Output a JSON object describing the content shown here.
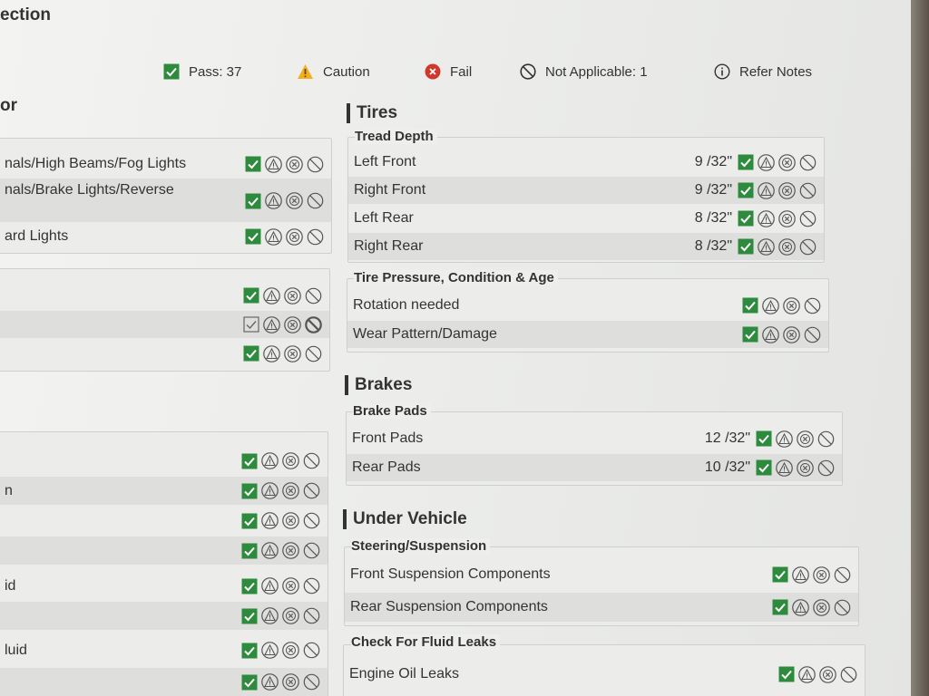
{
  "page": {
    "title": "ection"
  },
  "legend": {
    "pass": "Pass: 37",
    "caution": "Caution",
    "fail": "Fail",
    "na": "Not Applicable: 1",
    "notes": "Refer Notes"
  },
  "colors": {
    "pass_green": "#2e8b3e",
    "caution_yellow": "#f2b01e",
    "fail_red": "#d0382b",
    "icon_gray": "#555555"
  },
  "left": {
    "section1": {
      "title": "or",
      "items": [
        {
          "label": "nals/High Beams/Fog Lights"
        },
        {
          "label": "nals/Brake Lights/Reverse"
        },
        {
          "label": "ard Lights"
        }
      ]
    },
    "section2": {
      "items": [
        {
          "label": ""
        },
        {
          "label": ""
        },
        {
          "label": ""
        }
      ]
    },
    "section3": {
      "items": [
        {
          "label": ""
        },
        {
          "label": "n"
        },
        {
          "label": ""
        },
        {
          "label": ""
        },
        {
          "label": "id"
        },
        {
          "label": ""
        },
        {
          "label": "luid"
        },
        {
          "label": ""
        }
      ]
    }
  },
  "tires": {
    "title": "Tires",
    "tread": {
      "label": "Tread Depth",
      "items": [
        {
          "label": "Left Front",
          "value": "9 /32\""
        },
        {
          "label": "Right Front",
          "value": "9 /32\""
        },
        {
          "label": "Left Rear",
          "value": "8 /32\""
        },
        {
          "label": "Right Rear",
          "value": "8 /32\""
        }
      ]
    },
    "pressure": {
      "label": "Tire Pressure, Condition & Age",
      "items": [
        {
          "label": "Rotation needed"
        },
        {
          "label": "Wear Pattern/Damage"
        }
      ]
    }
  },
  "brakes": {
    "title": "Brakes",
    "pads": {
      "label": "Brake Pads",
      "items": [
        {
          "label": "Front Pads",
          "value": "12 /32\""
        },
        {
          "label": "Rear Pads",
          "value": "10 /32\""
        }
      ]
    }
  },
  "under": {
    "title": "Under Vehicle",
    "steering": {
      "label": "Steering/Suspension",
      "items": [
        {
          "label": "Front Suspension Components"
        },
        {
          "label": "Rear Suspension Components"
        }
      ]
    },
    "leaks": {
      "label": "Check For Fluid Leaks",
      "items": [
        {
          "label": "Engine Oil Leaks"
        }
      ]
    }
  }
}
